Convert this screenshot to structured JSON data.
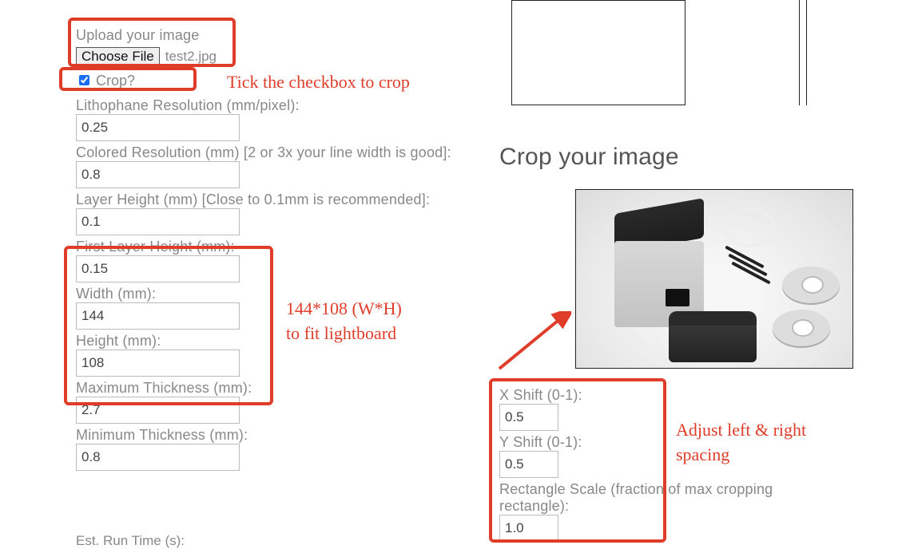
{
  "left": {
    "upload_label": "Upload your image",
    "choose_file_btn": "Choose File",
    "chosen_filename": "test2.jpg",
    "crop_checkbox_label": "Crop?",
    "crop_checked": true,
    "litho_res_label": "Lithophane Resolution (mm/pixel):",
    "litho_res_value": "0.25",
    "colored_res_label": "Colored Resolution (mm) [2 or 3x your line width is good]:",
    "colored_res_value": "0.8",
    "layer_height_label": "Layer Height (mm) [Close to 0.1mm is recommended]:",
    "layer_height_value": "0.1",
    "first_layer_label": "First Layer Height (mm):",
    "first_layer_value": "0.15",
    "width_label": "Width (mm):",
    "width_value": "144",
    "height_label": "Height (mm):",
    "height_value": "108",
    "max_thick_label": "Maximum Thickness (mm):",
    "max_thick_value": "2.7",
    "min_thick_label": "Minimum Thickness (mm):",
    "min_thick_value": "0.8",
    "est_run_label": "Est. Run Time (s):"
  },
  "right": {
    "crop_title": "Crop your image",
    "xshift_label": "X Shift (0-1):",
    "xshift_value": "0.5",
    "yshift_label": "Y Shift (0-1):",
    "yshift_value": "0.5",
    "rect_scale_label": "Rectangle Scale (fraction of max cropping rectangle):",
    "rect_scale_value": "1.0"
  },
  "annotations": {
    "tick_checkbox": "Tick the checkbox to crop",
    "dims_line1": "144*108 (W*H)",
    "dims_line2": "to fit lightboard",
    "spacing_line1": "Adjust left & right",
    "spacing_line2": "spacing"
  }
}
